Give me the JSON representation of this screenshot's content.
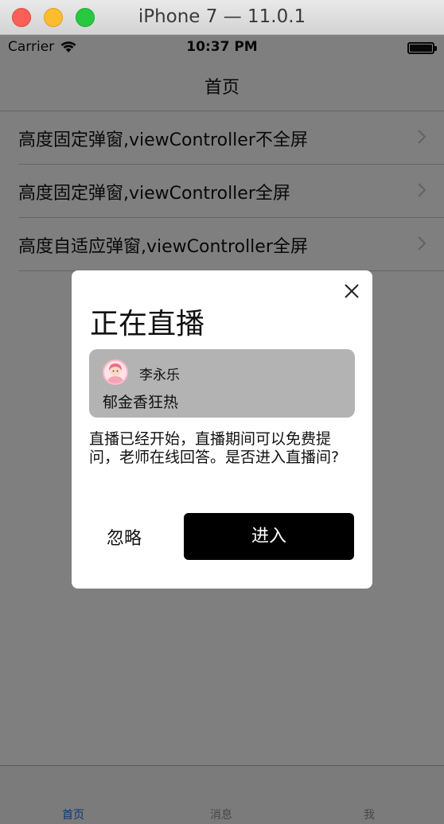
{
  "window": {
    "title": "iPhone 7 — 11.0.1"
  },
  "status_bar": {
    "carrier": "Carrier",
    "time": "10:37 PM"
  },
  "nav": {
    "title": "首页"
  },
  "list": {
    "items": [
      {
        "label": "高度固定弹窗,viewController不全屏"
      },
      {
        "label": "高度固定弹窗,viewController全屏"
      },
      {
        "label": "高度自适应弹窗,viewController全屏"
      }
    ]
  },
  "tabs": [
    {
      "label": "首页",
      "selected": true
    },
    {
      "label": "消息",
      "selected": false
    },
    {
      "label": "我",
      "selected": false
    }
  ],
  "alert": {
    "title": "正在直播",
    "anchor_name": "李永乐",
    "topic": "郁金香狂热",
    "message": "直播已经开始，直播期间可以免费提问，老师在线回答。是否进入直播间?",
    "ignore_label": "忽略",
    "enter_label": "进入"
  },
  "colors": {
    "accent_tab": "#1d6ee6",
    "enter_button": "#000000",
    "card_bg": "#b3b3b3"
  },
  "icons": {
    "close": "close-icon",
    "chevron": "chevron-right-icon",
    "wifi": "wifi-icon",
    "battery": "battery-icon",
    "avatar": "avatar-icon"
  }
}
